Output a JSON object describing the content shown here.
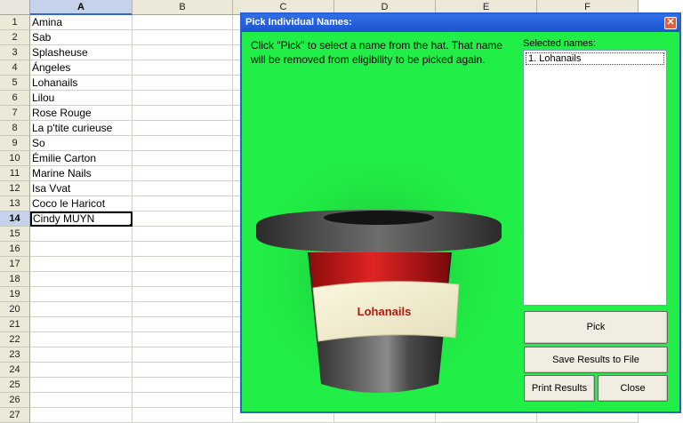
{
  "sheet": {
    "columns": [
      "A",
      "B",
      "C",
      "D",
      "E",
      "F"
    ],
    "selected_column": "A",
    "active_row": 14,
    "rows": [
      {
        "num": "1",
        "a": "Amina"
      },
      {
        "num": "2",
        "a": "Sab"
      },
      {
        "num": "3",
        "a": "Splasheuse"
      },
      {
        "num": "4",
        "a": "Ángeles"
      },
      {
        "num": "5",
        "a": "Lohanails"
      },
      {
        "num": "6",
        "a": "Lilou"
      },
      {
        "num": "7",
        "a": "Rose Rouge"
      },
      {
        "num": "8",
        "a": "La p'tite curieuse"
      },
      {
        "num": "9",
        "a": "So"
      },
      {
        "num": "10",
        "a": "Émilie Carton"
      },
      {
        "num": "11",
        "a": "Marine Nails"
      },
      {
        "num": "12",
        "a": "Isa Vvat"
      },
      {
        "num": "13",
        "a": "Coco le Haricot"
      },
      {
        "num": "14",
        "a": "Cindy MUYN"
      },
      {
        "num": "15",
        "a": ""
      },
      {
        "num": "16",
        "a": ""
      },
      {
        "num": "17",
        "a": ""
      },
      {
        "num": "18",
        "a": ""
      },
      {
        "num": "19",
        "a": ""
      },
      {
        "num": "20",
        "a": ""
      },
      {
        "num": "21",
        "a": ""
      },
      {
        "num": "22",
        "a": ""
      },
      {
        "num": "23",
        "a": ""
      },
      {
        "num": "24",
        "a": ""
      },
      {
        "num": "25",
        "a": ""
      },
      {
        "num": "26",
        "a": ""
      },
      {
        "num": "27",
        "a": ""
      }
    ]
  },
  "dialog": {
    "title": "Pick Individual Names:",
    "close_glyph": "✕",
    "instructions": "Click \"Pick\" to select a name from the hat. That name will be removed from eligibility to be picked again.",
    "selected_label": "Selected names:",
    "selected_items": [
      "1. Lohanails"
    ],
    "hat_label": "Lohanails",
    "buttons": {
      "pick": "Pick",
      "save": "Save Results to File",
      "print": "Print Results",
      "close": "Close"
    },
    "colors": {
      "background": "#21ee46",
      "hat_band": "#d11a1a",
      "hat_body": "#3a3a3a"
    }
  }
}
